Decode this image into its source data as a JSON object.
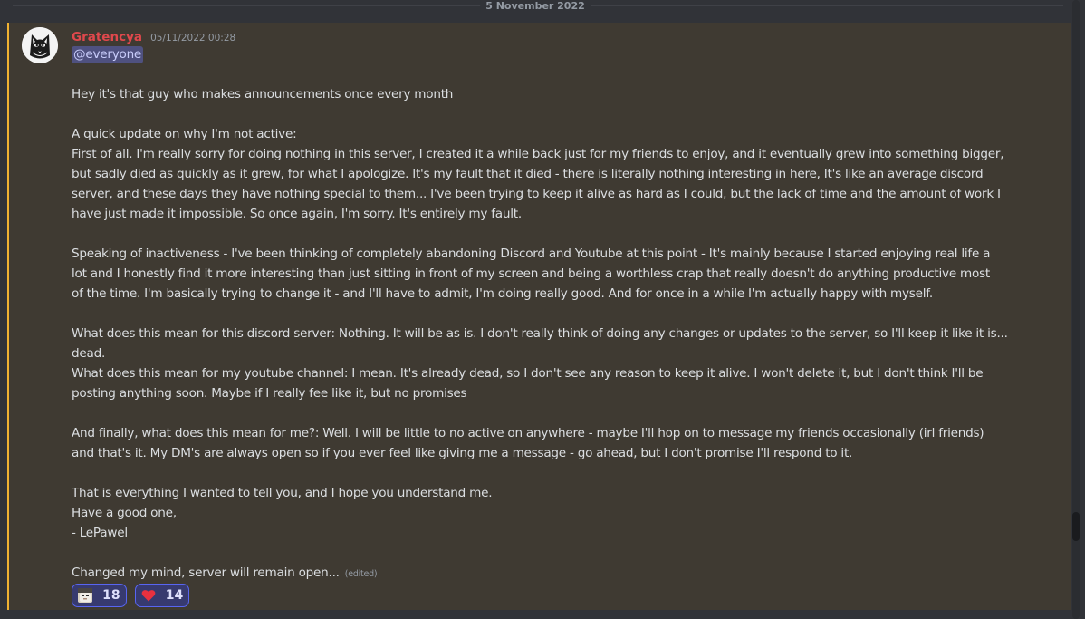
{
  "divider": {
    "date": "5 November 2022"
  },
  "message": {
    "username": "Gratencya",
    "timestamp": "05/11/2022 00:28",
    "mention": "@everyone",
    "avatar_icon": "black-cat-avatar",
    "lines": [
      "",
      "Hey it's that guy who makes announcements once every month",
      "",
      "A quick update on why I'm not active:",
      "First of all. I'm really sorry for doing nothing in this server, I created it a while back just for my friends to enjoy, and it eventually grew into something bigger,",
      "but sadly died as quickly as it grew, for what I apologize. It's my fault that it died - there is literally nothing interesting in here, It's like an average discord",
      "server, and these days they have nothing special to them... I've been trying to keep it alive as hard as I could, but the lack of time and the amount of work I",
      "have just made it impossible. So once again, I'm sorry. It's entirely my fault.",
      "",
      "Speaking of inactiveness - I've been thinking of completely abandoning Discord and Youtube at this point - It's mainly because I started enjoying real life a",
      "lot and I honestly find it more interesting than just sitting in front of my screen and being a worthless crap that really doesn't do anything productive most",
      "of the time. I'm basically trying to change it - and I'll have to admit, I'm doing really good. And for once in a while I'm actually happy with myself.",
      "",
      "What does this mean for this discord server: Nothing. It will be as is. I don't really think of doing any changes or updates to the server, so I'll keep it like it is...",
      "dead.",
      "What does this mean for my youtube channel: I mean. It's already dead, so I don't see any reason to keep it alive. I won't delete it, but I don't think I'll be",
      "posting anything soon. Maybe if I really fee like it, but no promises",
      "",
      "And finally, what does this mean for me?: Well. I will be little to no active on anywhere - maybe I'll hop on to message my friends occasionally (irl friends)",
      "and that's it. My DM's are always open so if you ever feel like giving me a message - go ahead, but I don't promise I'll respond to it.",
      "",
      "That is everything I wanted to tell you, and I hope you understand me.",
      "Have a good one,",
      "- LePawel",
      ""
    ],
    "last_line": "Changed my mind, server will remain open...",
    "edited_label": "(edited)"
  },
  "reactions": [
    {
      "emoji_icon": "cat-face-emoji",
      "count": "18"
    },
    {
      "emoji_icon": "red-heart-emoji",
      "count": "14"
    }
  ],
  "colors": {
    "background": "#313338",
    "mention_highlight": "#3f3a32",
    "mention_bar": "#f0b232",
    "username": "#e0484c",
    "reaction_border": "#5865f2"
  }
}
